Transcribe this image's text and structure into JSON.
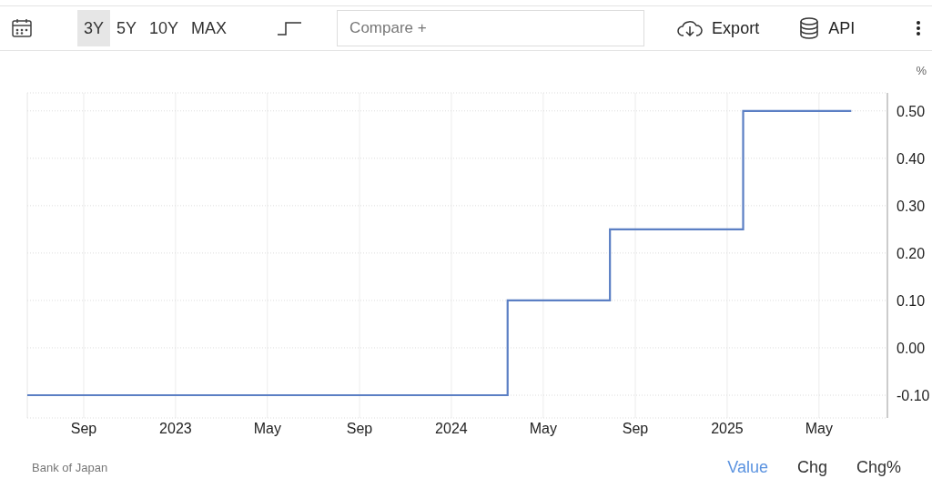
{
  "toolbar": {
    "ranges": [
      {
        "label": "3Y",
        "selected": true
      },
      {
        "label": "5Y",
        "selected": false
      },
      {
        "label": "10Y",
        "selected": false
      },
      {
        "label": "MAX",
        "selected": false
      }
    ],
    "compare": {
      "placeholder": "Compare +"
    },
    "export": {
      "label": "Export"
    },
    "api": {
      "label": "API"
    }
  },
  "chart": {
    "unit": "%",
    "chart_data": {
      "type": "line",
      "grid": true,
      "xlim": [
        2022.4625,
        2025.581
      ],
      "ylim": [
        -0.148,
        0.538
      ],
      "xticks": [
        {
          "value": 2022.667,
          "label": "Sep"
        },
        {
          "value": 2023,
          "label": "2023"
        },
        {
          "value": 2023.333,
          "label": "May"
        },
        {
          "value": 2023.667,
          "label": "Sep"
        },
        {
          "value": 2024,
          "label": "2024"
        },
        {
          "value": 2024.333,
          "label": "May"
        },
        {
          "value": 2024.667,
          "label": "Sep"
        },
        {
          "value": 2025,
          "label": "2025"
        },
        {
          "value": 2025.333,
          "label": "May"
        }
      ],
      "yticks": [
        {
          "value": 0.5,
          "label": "0.50"
        },
        {
          "value": 0.4,
          "label": "0.40"
        },
        {
          "value": 0.3,
          "label": "0.30"
        },
        {
          "value": 0.2,
          "label": "0.20"
        },
        {
          "value": 0.1,
          "label": "0.10"
        },
        {
          "value": 0,
          "label": "0.00"
        },
        {
          "value": -0.1,
          "label": "-0.10"
        }
      ],
      "x": [
        2022.4625,
        2024.204,
        2024.204,
        2024.575,
        2024.575,
        2025.058,
        2025.058,
        2025.45
      ],
      "series": [
        {
          "color": "#5b7fc4",
          "values": [
            -0.1,
            -0.1,
            0.1,
            0.1,
            0.25,
            0.25,
            0.5,
            0.5
          ]
        }
      ]
    }
  },
  "footer": {
    "source": "Bank of Japan",
    "views": [
      {
        "label": "Value",
        "selected": true
      },
      {
        "label": "Chg",
        "selected": false
      },
      {
        "label": "Chg%",
        "selected": false
      }
    ]
  }
}
